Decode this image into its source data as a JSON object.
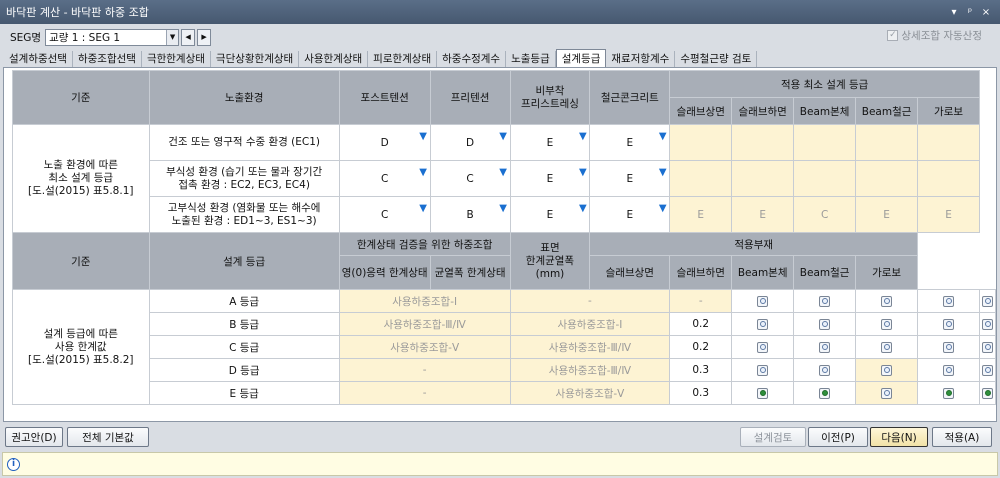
{
  "window": {
    "title": "바닥판 계산 - 바닥판 하중 조합",
    "controls": [
      "▾",
      "ᵖ",
      "×"
    ]
  },
  "seg": {
    "label": "SEG명",
    "value": "교량 1 : SEG 1",
    "auto_check_label": "상세조합 자동산정",
    "auto_check_mark": "✓"
  },
  "tabs": [
    {
      "label": "설계하중선택"
    },
    {
      "label": "하중조합선택"
    },
    {
      "label": "극한한계상태"
    },
    {
      "label": "극단상황한계상태"
    },
    {
      "label": "사용한계상태"
    },
    {
      "label": "피로한계상태"
    },
    {
      "label": "하중수정계수"
    },
    {
      "label": "노출등급"
    },
    {
      "label": "설계등급",
      "active": true
    },
    {
      "label": "재료저항계수"
    },
    {
      "label": "수평철근량 검토"
    }
  ],
  "exposure": {
    "h_criteria": "기준",
    "h_env": "노출환경",
    "h_post": "포스트텐션",
    "h_pre": "프리텐션",
    "h_nonpre": "비부착\n프리스트레싱",
    "h_rc": "철근콘크리트",
    "h_min": "적용 최소 설계 등급",
    "sub": [
      "슬래브상면",
      "슬래브하면",
      "Beam본체",
      "Beam철근",
      "가로보"
    ],
    "criteria_label": "노출 환경에 따른\n최소 설계 등급\n[도.설(2015) 표5.8.1]",
    "rows": [
      {
        "env": "건조 또는 영구적 수중 환경 (EC1)",
        "post": "D",
        "pre": "D",
        "nonpre": "E",
        "rc": "E",
        "min": [
          "",
          "",
          "",
          "",
          ""
        ]
      },
      {
        "env": "부식성 환경 (습기 또는 물과 장기간\n접촉 환경 : EC2, EC3, EC4)",
        "post": "C",
        "pre": "C",
        "nonpre": "E",
        "rc": "E",
        "min": [
          "",
          "",
          "",
          "",
          ""
        ]
      },
      {
        "env": "고부식성 환경 (염화물 또는 해수에\n노출된 환경 : ED1~3, ES1~3)",
        "post": "C",
        "pre": "B",
        "nonpre": "E",
        "rc": "E",
        "min": [
          "E",
          "E",
          "C",
          "E",
          "E"
        ]
      }
    ]
  },
  "design": {
    "h_criteria": "기준",
    "h_grade": "설계 등급",
    "h_combo": "한계상태 검증을 위한 하중조합",
    "h_zero": "영(0)응력 한계상태",
    "h_crack": "균열폭 한계상태",
    "h_width": "표면\n한계균열폭\n(mm)",
    "h_members": "적용부재",
    "sub": [
      "슬래브상면",
      "슬래브하면",
      "Beam본체",
      "Beam철근",
      "가로보"
    ],
    "criteria_label": "설계 등급에 따른\n사용 한계값\n[도.설(2015) 표5.8.2]",
    "rows": [
      {
        "grade": "A 등급",
        "zero": "사용하중조합-Ⅰ",
        "crack": "-",
        "width": "-",
        "sel": [
          false,
          false,
          false,
          false,
          false
        ]
      },
      {
        "grade": "B 등급",
        "zero": "사용하중조합-Ⅲ/Ⅳ",
        "crack": "사용하중조합-Ⅰ",
        "width": "0.2",
        "sel": [
          false,
          false,
          false,
          false,
          false
        ]
      },
      {
        "grade": "C 등급",
        "zero": "사용하중조합-Ⅴ",
        "crack": "사용하중조합-Ⅲ/Ⅳ",
        "width": "0.2",
        "sel": [
          false,
          false,
          false,
          false,
          false
        ]
      },
      {
        "grade": "D 등급",
        "zero": "-",
        "crack": "사용하중조합-Ⅲ/Ⅳ",
        "width": "0.3",
        "sel": [
          false,
          false,
          false,
          false,
          false
        ]
      },
      {
        "grade": "E 등급",
        "zero": "-",
        "crack": "사용하중조합-Ⅴ",
        "width": "0.3",
        "sel": [
          true,
          true,
          false,
          true,
          true
        ]
      }
    ]
  },
  "buttons": {
    "recommend": "권고안(D)",
    "all_default": "전체 기본값",
    "design_check": "설계검토",
    "prev": "이전(P)",
    "next": "다음(N)",
    "apply": "적용(A)"
  },
  "status": {
    "icon": "info-icon",
    "text": ""
  }
}
